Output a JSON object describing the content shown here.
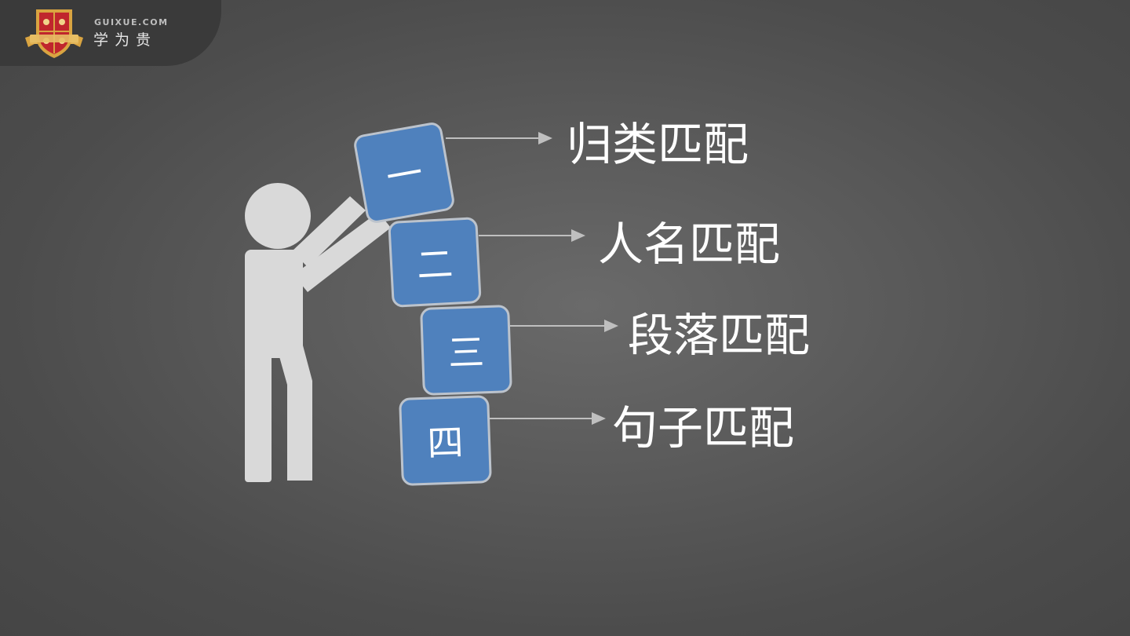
{
  "logo": {
    "domain": "GUIXUE.COM",
    "name": "学为贵"
  },
  "blocks": [
    {
      "numeral": "一",
      "label": "归类匹配"
    },
    {
      "numeral": "二",
      "label": "人名匹配"
    },
    {
      "numeral": "三",
      "label": "段落匹配"
    },
    {
      "numeral": "四",
      "label": "句子匹配"
    }
  ],
  "colors": {
    "block_fill": "#4f81bd",
    "block_border": "#bcc3cc",
    "figure": "#d9d9d9",
    "arrow": "#bfbfbf",
    "logo_red": "#c0262d",
    "logo_gold": "#d9a441"
  }
}
